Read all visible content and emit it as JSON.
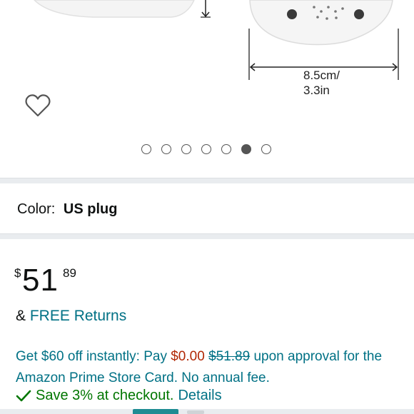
{
  "product_image": {
    "dimension_cm": "8.5cm/",
    "dimension_in": "3.3in"
  },
  "wishlist": {
    "icon": "heart-outline-icon"
  },
  "carousel": {
    "count": 7,
    "active_index": 5
  },
  "variation": {
    "label": "Color:",
    "value": "US plug"
  },
  "price": {
    "symbol": "$",
    "whole": "51",
    "fraction": "89"
  },
  "returns": {
    "prefix": "&",
    "link": "FREE Returns"
  },
  "promo": {
    "text_1": "Get $60 off instantly: Pay ",
    "pay_amount": "$0.00",
    "original_amount": "$51.89",
    "text_2": " upon approval for the Amazon Prime Store Card. No annual fee."
  },
  "savings": {
    "text": "Save 3% at checkout.",
    "link": "Details"
  },
  "colors": {
    "link": "#007185",
    "price_red": "#b12704",
    "green": "#007600"
  }
}
